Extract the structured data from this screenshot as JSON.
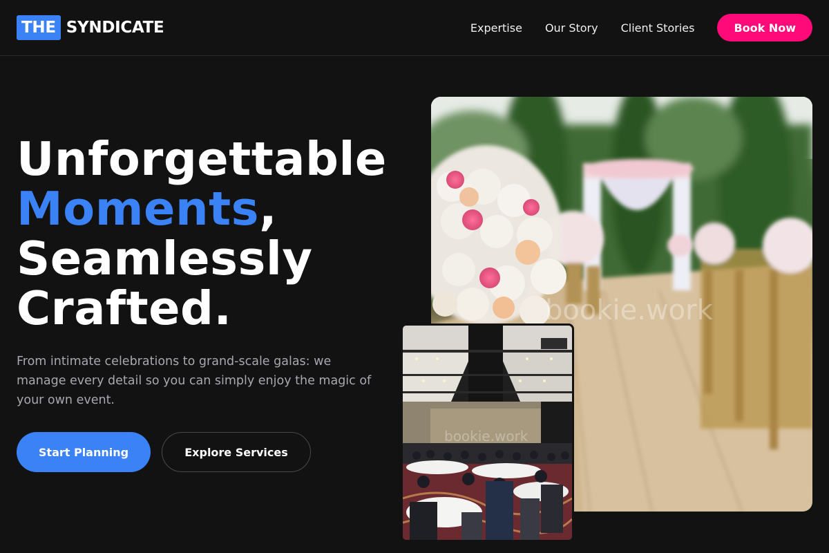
{
  "brand": {
    "box_text": "THE",
    "name": "SYNDICATE",
    "accent_color": "#3b82f6"
  },
  "nav": {
    "links": [
      "Expertise",
      "Our Story",
      "Client Stories"
    ],
    "cta_label": "Book Now",
    "cta_color": "#ff0a78"
  },
  "hero": {
    "headline_line1": "Unforgettable",
    "headline_accent": "Moments",
    "headline_comma": ",",
    "headline_line3": "Seamlessly",
    "headline_line4": "Crafted.",
    "subtext": "From intimate celebrations to grand-scale galas: we manage every detail so you can simply enjoy the magic of your own event.",
    "primary_button": "Start Planning",
    "secondary_button": "Explore Services"
  },
  "images": {
    "main_watermark": "bookie.work",
    "inset_watermark": "bookie.work",
    "main_description_icon": "wedding-aisle-photo",
    "inset_description_icon": "banquet-hall-photo"
  }
}
